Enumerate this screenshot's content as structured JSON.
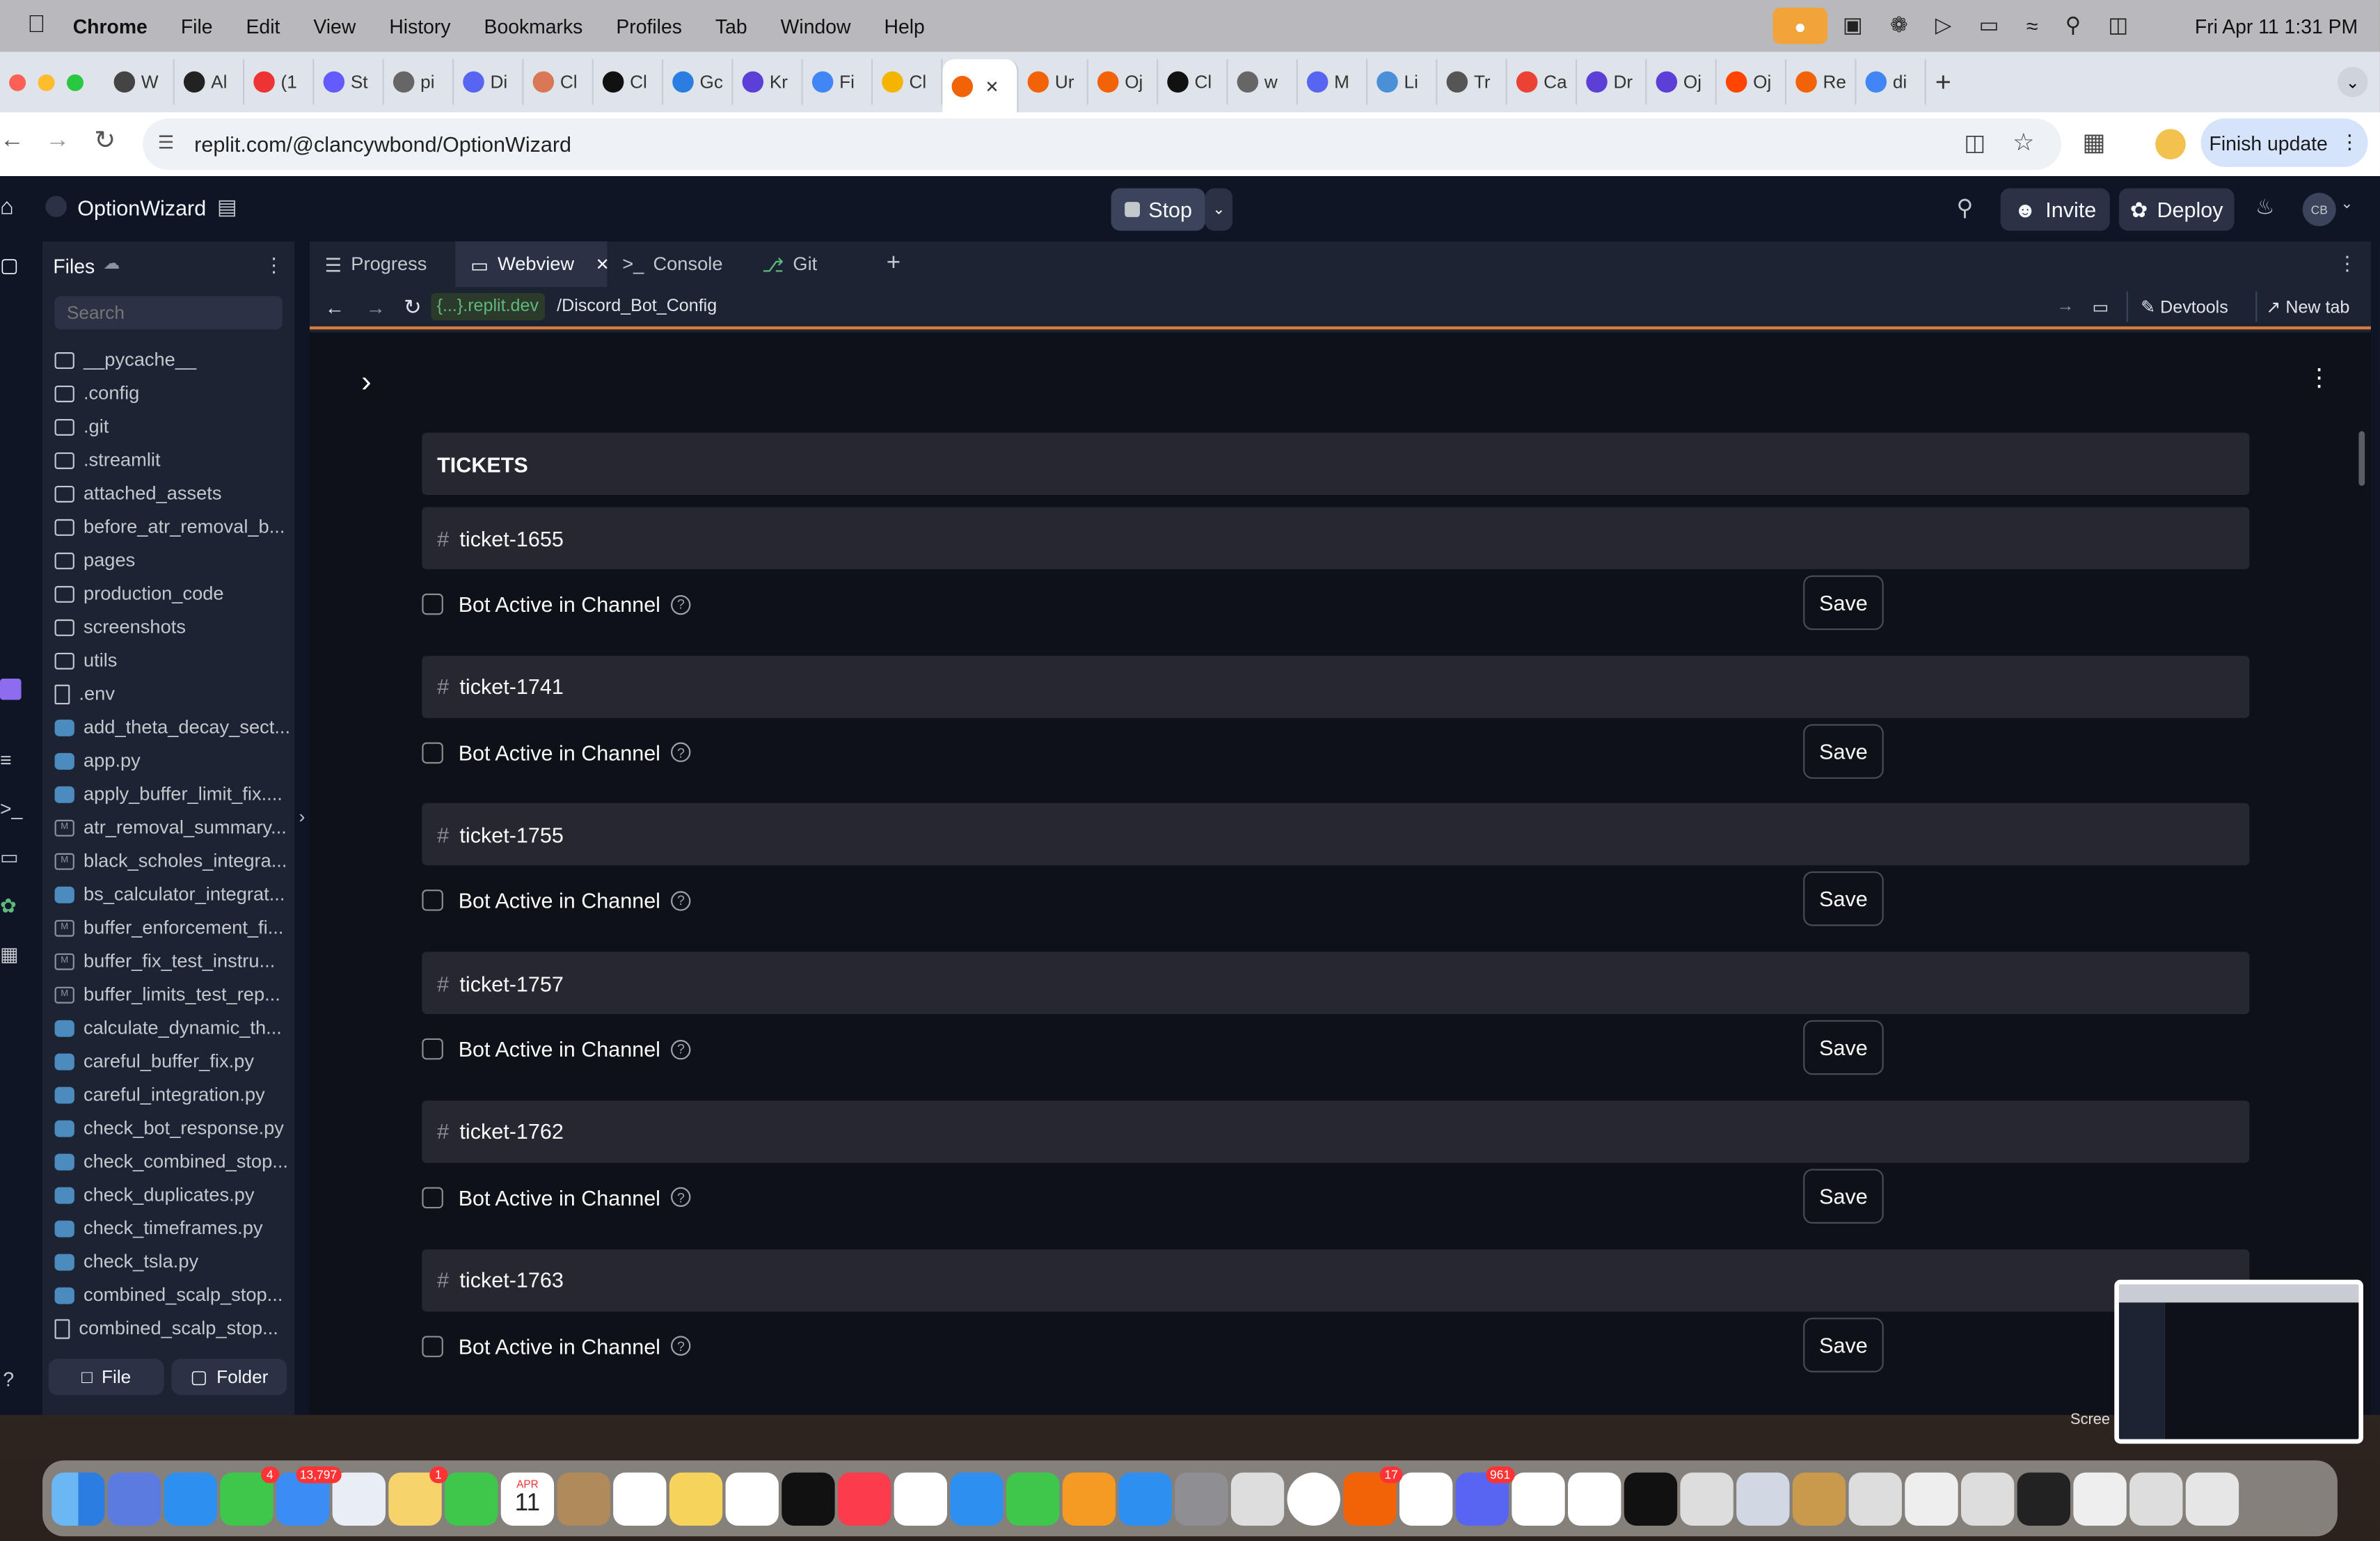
{
  "menubar": {
    "app": "Chrome",
    "items": [
      "File",
      "Edit",
      "View",
      "History",
      "Bookmarks",
      "Profiles",
      "Tab",
      "Window",
      "Help"
    ],
    "datetime": "Fri Apr 11  1:31 PM"
  },
  "browser": {
    "tabs": [
      {
        "label": "W",
        "color": "#444"
      },
      {
        "label": "Al",
        "color": "#222"
      },
      {
        "label": "(1",
        "color": "#e33"
      },
      {
        "label": "St",
        "color": "#635bff"
      },
      {
        "label": "pi",
        "color": "#666"
      },
      {
        "label": "Di",
        "color": "#5865f2"
      },
      {
        "label": "Cl",
        "color": "#d97757"
      },
      {
        "label": "Cl",
        "color": "#111"
      },
      {
        "label": "Gc",
        "color": "#2a7de1"
      },
      {
        "label": "Kr",
        "color": "#5b3fd6"
      },
      {
        "label": "Fi",
        "color": "#4285f4"
      },
      {
        "label": "Cl",
        "color": "#f4b400"
      },
      {
        "label": "",
        "color": "#f26207",
        "active": true
      },
      {
        "label": "Ur",
        "color": "#f26207"
      },
      {
        "label": "Oj",
        "color": "#f26207"
      },
      {
        "label": "Cl",
        "color": "#111"
      },
      {
        "label": "w",
        "color": "#666"
      },
      {
        "label": "M",
        "color": "#5865f2"
      },
      {
        "label": "Li",
        "color": "#4a90d9"
      },
      {
        "label": "Tr",
        "color": "#555"
      },
      {
        "label": "Ca",
        "color": "#ea4335"
      },
      {
        "label": "Dr",
        "color": "#5b3fd6"
      },
      {
        "label": "Oj",
        "color": "#5b3fd6"
      },
      {
        "label": "Oj",
        "color": "#ff4500"
      },
      {
        "label": "Re",
        "color": "#f26207"
      },
      {
        "label": "di",
        "color": "#4285f4"
      }
    ],
    "url": "replit.com/@clancywbond/OptionWizard",
    "finish_update": "Finish update"
  },
  "replit": {
    "project": "OptionWizard",
    "stop": "Stop",
    "invite": "Invite",
    "deploy": "Deploy",
    "avatar": "CB",
    "files": {
      "title": "Files",
      "search_placeholder": "Search",
      "items": [
        {
          "name": "__pycache__",
          "type": "folder"
        },
        {
          "name": ".config",
          "type": "folder"
        },
        {
          "name": ".git",
          "type": "folder"
        },
        {
          "name": ".streamlit",
          "type": "folder"
        },
        {
          "name": "attached_assets",
          "type": "folder"
        },
        {
          "name": "before_atr_removal_b...",
          "type": "folder"
        },
        {
          "name": "pages",
          "type": "folder"
        },
        {
          "name": "production_code",
          "type": "folder"
        },
        {
          "name": "screenshots",
          "type": "folder"
        },
        {
          "name": "utils",
          "type": "folder"
        },
        {
          "name": ".env",
          "type": "file"
        },
        {
          "name": "add_theta_decay_sect...",
          "type": "py"
        },
        {
          "name": "app.py",
          "type": "py"
        },
        {
          "name": "apply_buffer_limit_fix....",
          "type": "py"
        },
        {
          "name": "atr_removal_summary...",
          "type": "md"
        },
        {
          "name": "black_scholes_integra...",
          "type": "md"
        },
        {
          "name": "bs_calculator_integrat...",
          "type": "py"
        },
        {
          "name": "buffer_enforcement_fi...",
          "type": "md"
        },
        {
          "name": "buffer_fix_test_instru...",
          "type": "md"
        },
        {
          "name": "buffer_limits_test_rep...",
          "type": "md"
        },
        {
          "name": "calculate_dynamic_th...",
          "type": "py"
        },
        {
          "name": "careful_buffer_fix.py",
          "type": "py"
        },
        {
          "name": "careful_integration.py",
          "type": "py"
        },
        {
          "name": "check_bot_response.py",
          "type": "py"
        },
        {
          "name": "check_combined_stop...",
          "type": "py"
        },
        {
          "name": "check_duplicates.py",
          "type": "py"
        },
        {
          "name": "check_timeframes.py",
          "type": "py"
        },
        {
          "name": "check_tsla.py",
          "type": "py"
        },
        {
          "name": "combined_scalp_stop...",
          "type": "py"
        },
        {
          "name": "combined_scalp_stop...",
          "type": "file"
        }
      ],
      "new_file": "File",
      "new_folder": "Folder"
    },
    "pane_tabs": [
      "Progress",
      "Webview",
      "Console",
      "Git"
    ],
    "webview": {
      "domain": "{...}.replit.dev",
      "path": "/Discord_Bot_Config",
      "devtools": "Devtools",
      "new_tab": "New tab"
    },
    "page": {
      "section_title": "TICKETS",
      "checkbox_label": "Bot Active in Channel",
      "save_label": "Save",
      "tickets": [
        "ticket-1655",
        "ticket-1741",
        "ticket-1755",
        "ticket-1757",
        "ticket-1762",
        "ticket-1763"
      ]
    }
  },
  "dock": {
    "badges": {
      "messages": "4",
      "mail": "13,797",
      "photos": "1",
      "slack": "17",
      "discord": "961"
    },
    "calendar": {
      "month": "APR",
      "day": "11"
    }
  },
  "desktop": {
    "screenshot_label": "Scree"
  }
}
